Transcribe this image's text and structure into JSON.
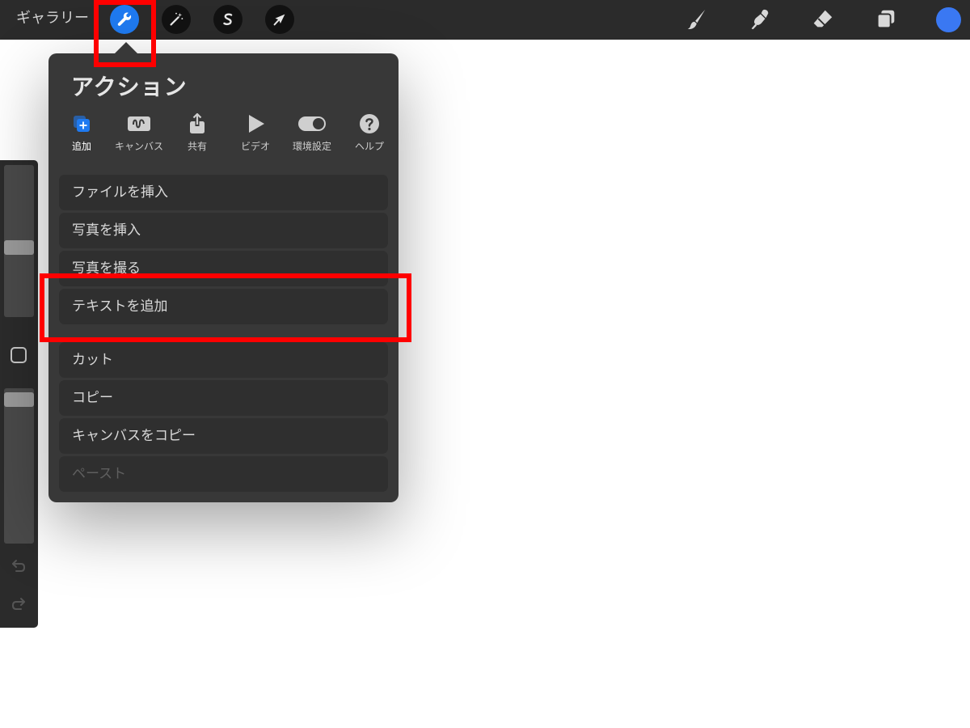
{
  "toolbar": {
    "gallery_label": "ギャラリー",
    "left_tools": [
      {
        "icon": "wrench-icon",
        "active": true
      },
      {
        "icon": "magic-wand-icon",
        "active": false
      },
      {
        "icon": "selection-s-icon",
        "active": false
      },
      {
        "icon": "transform-arrow-icon",
        "active": false
      }
    ],
    "right_tools": [
      "brush-icon",
      "smudge-icon",
      "eraser-icon",
      "layers-icon"
    ],
    "current_color": "#3a78f2"
  },
  "popover": {
    "title": "アクション",
    "tabs": [
      {
        "label": "追加",
        "icon": "add-icon",
        "active": true
      },
      {
        "label": "キャンバス",
        "icon": "canvas-icon",
        "active": false
      },
      {
        "label": "共有",
        "icon": "share-icon",
        "active": false
      },
      {
        "label": "ビデオ",
        "icon": "video-play-icon",
        "active": false
      },
      {
        "label": "環境設定",
        "icon": "toggle-icon",
        "active": false
      },
      {
        "label": "ヘルプ",
        "icon": "help-icon",
        "active": false
      }
    ],
    "items": [
      {
        "label": "ファイルを挿入",
        "enabled": true
      },
      {
        "label": "写真を挿入",
        "enabled": true
      },
      {
        "label": "写真を撮る",
        "enabled": true
      },
      {
        "label": "テキストを追加",
        "enabled": true
      },
      {
        "label": "カット",
        "enabled": true
      },
      {
        "label": "コピー",
        "enabled": true
      },
      {
        "label": "キャンバスをコピー",
        "enabled": true
      },
      {
        "label": "ペースト",
        "enabled": false
      }
    ]
  },
  "colors": {
    "accent": "#1f7af0",
    "highlight": "#ff0000",
    "panel": "#383838",
    "toolbar": "#2b2b2b"
  }
}
